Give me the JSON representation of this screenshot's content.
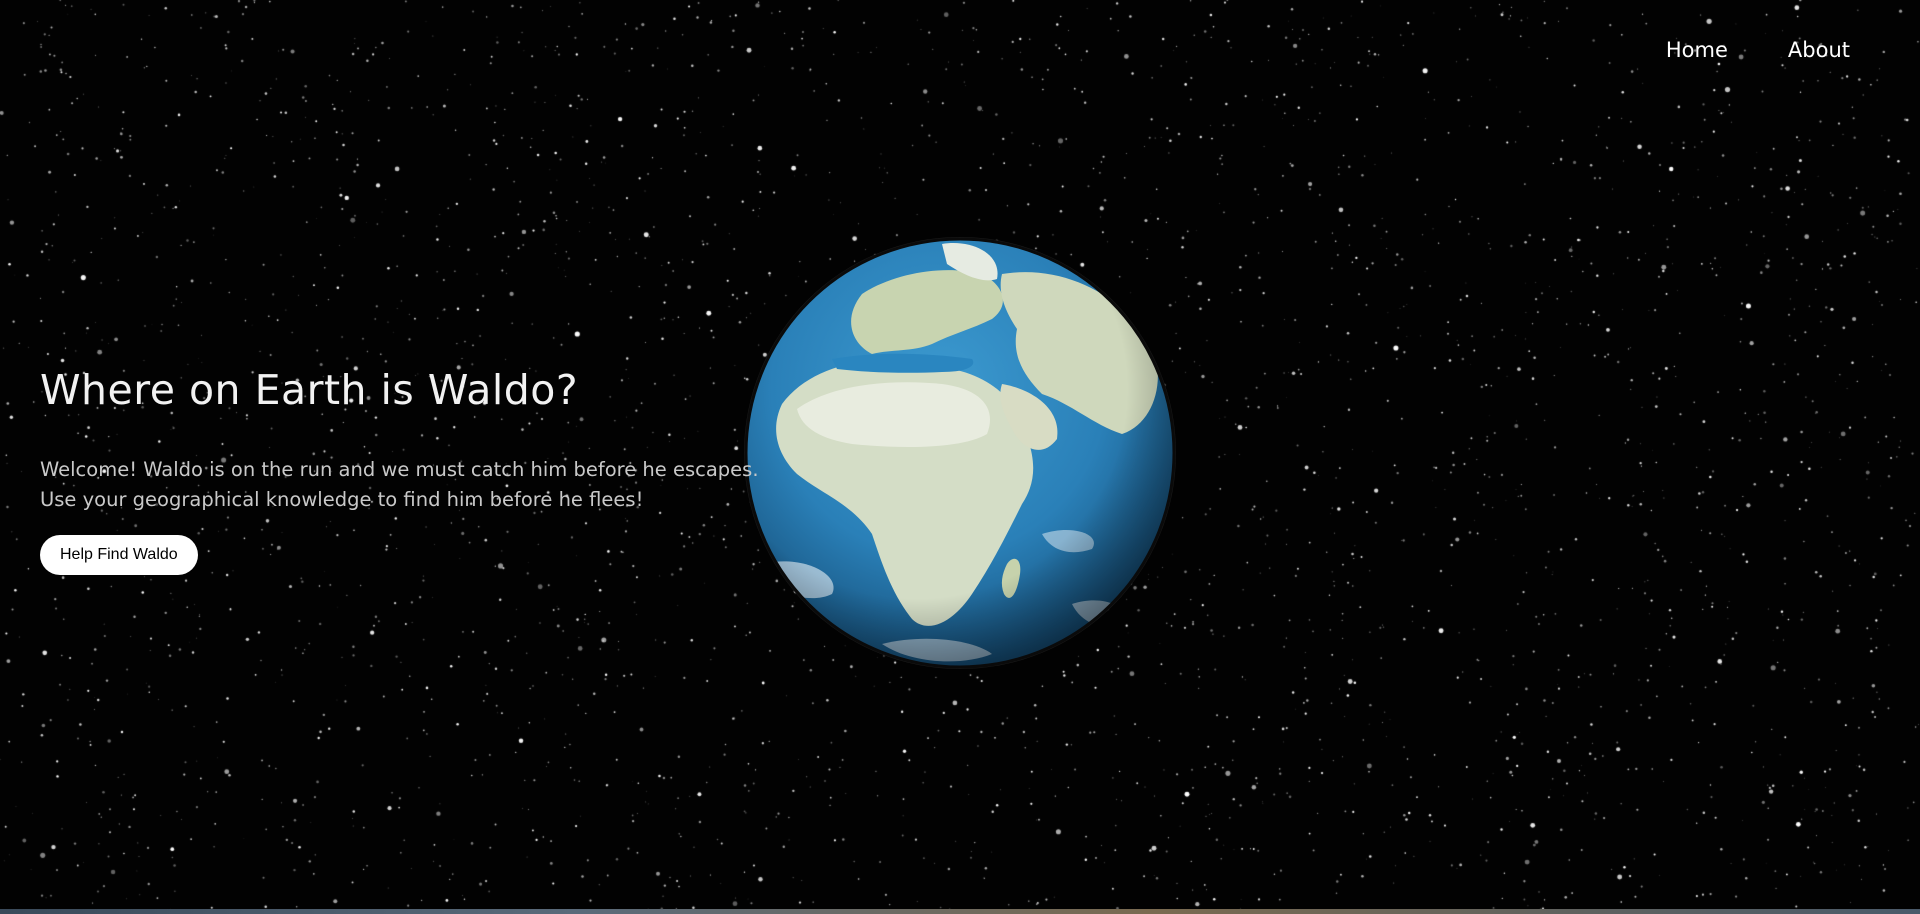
{
  "nav": {
    "items": [
      {
        "label": "Home"
      },
      {
        "label": "About"
      }
    ]
  },
  "hero": {
    "title": "Where on Earth is Waldo?",
    "line1": "Welcome! Waldo is on the run and we must catch him before he escapes.",
    "line2": "Use your geographical knowledge to find him before he flees!",
    "cta_label": "Help Find Waldo"
  },
  "colors": {
    "background": "#000000",
    "text": "#ffffff",
    "ocean": "#2a86c0",
    "land": "#d6dcc8",
    "button_bg": "#ffffff",
    "button_text": "#000000"
  }
}
